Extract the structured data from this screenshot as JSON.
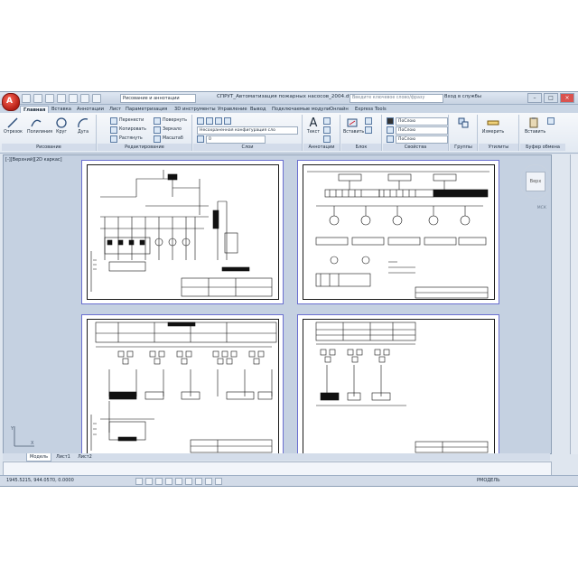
{
  "window": {
    "workspace": "Рисование и аннотации",
    "title": "СПРУТ_Автоматизация пожарных насосов_2004.dwg",
    "search_placeholder": "Введите ключевое слово/фразу",
    "login": "Вход в службы"
  },
  "tabs": [
    "Главная",
    "Вставка",
    "Аннотации",
    "Лист",
    "Параметризация",
    "3D инструменты",
    "Управление",
    "Вывод",
    "Подключаемые модули",
    "Онлайн",
    "Express Tools"
  ],
  "ribbon": {
    "draw": {
      "label": "Рисование",
      "tools": [
        "Отрезок",
        "Полилиния",
        "Круг",
        "Дуга"
      ]
    },
    "modify": {
      "label": "Редактирование",
      "tools": [
        "Перенести",
        "Повернуть",
        "Копировать",
        "Зеркало",
        "Растянуть",
        "Масштаб"
      ]
    },
    "layers": {
      "label": "Слои",
      "state": "Несохраненная конфигурация сло",
      "layer": "0"
    },
    "annotation": {
      "label": "Аннотации",
      "tools": [
        "Текст"
      ]
    },
    "block": {
      "label": "Блок",
      "tools": [
        "Вставить"
      ]
    },
    "properties": {
      "label": "Свойства",
      "values": [
        "ПоСлою",
        "ПоСлою",
        "ПоСлою"
      ]
    },
    "groups": {
      "label": "Группы",
      "tools": [
        "Группа"
      ]
    },
    "utilities": {
      "label": "Утилиты",
      "tools": [
        "Измерить"
      ]
    },
    "clipboard": {
      "label": "Буфер обмена",
      "tools": [
        "Вставить"
      ]
    }
  },
  "viewport": {
    "label": "[-][Верхний][2D каркас]",
    "navcube": "Верх",
    "navcube_sub": "МСК"
  },
  "layout_tabs": [
    "Модель",
    "Лист1",
    "Лист2"
  ],
  "status": {
    "coords": "1945.5215, 944.0570, 0.0000",
    "model": "РМОДЕЛЬ"
  }
}
